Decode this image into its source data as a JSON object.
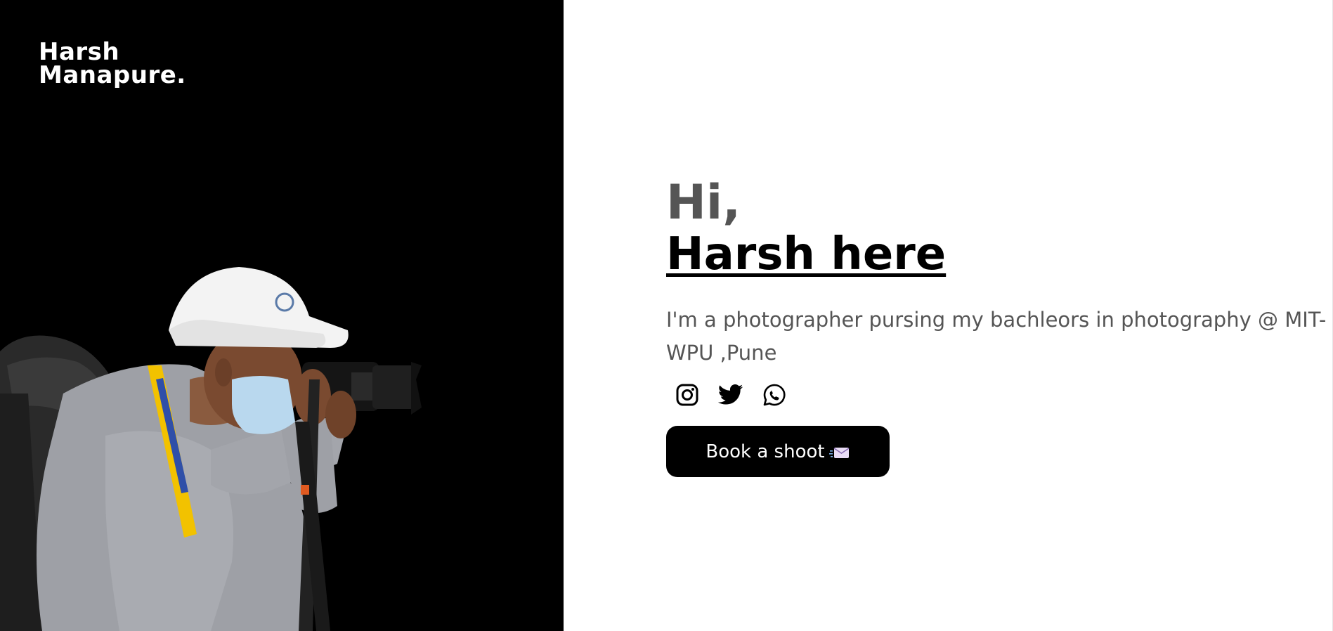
{
  "brand": {
    "line1": "Harsh",
    "line2": "Manapure."
  },
  "hero": {
    "greeting": "Hi,",
    "name": "Harsh here",
    "bio": "I'm a photographer pursing my bachleors in photography @ MIT-WPU ,Pune"
  },
  "socials": [
    {
      "icon": "instagram-icon"
    },
    {
      "icon": "twitter-icon"
    },
    {
      "icon": "whatsapp-icon"
    }
  ],
  "cta": {
    "label": "Book a shoot",
    "icon": "envelope-icon"
  },
  "colors": {
    "left_bg": "#000000",
    "right_bg": "#ffffff",
    "greeting": "#555555",
    "name": "#000000",
    "bio": "#555555",
    "button_bg": "#000000",
    "button_text": "#ffffff"
  }
}
